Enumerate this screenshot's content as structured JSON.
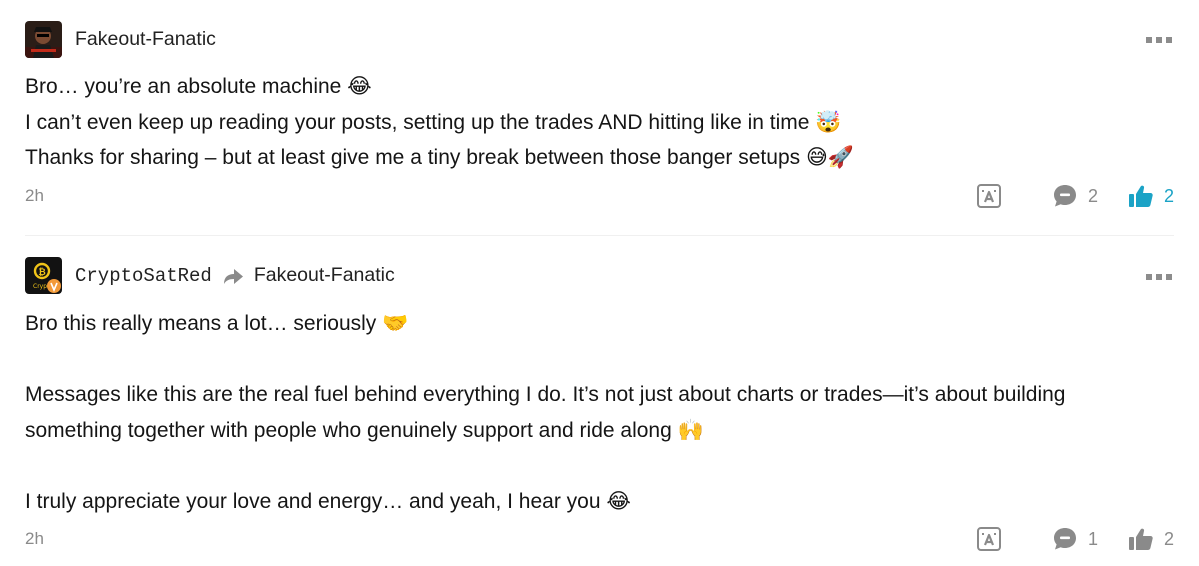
{
  "comments": [
    {
      "author": "Fakeout-Fanatic",
      "lines": [
        "Bro… you’re an absolute machine 😂",
        "I can’t even keep up reading your posts, setting up the trades AND hitting like in time 🤯",
        "Thanks for sharing – but at least give me a tiny break between those banger setups 😅🚀"
      ],
      "time": "2h",
      "reply_count": "2",
      "like_count": "2",
      "liked": true
    },
    {
      "author": "CryptoSatRed",
      "reply_to": "Fakeout-Fanatic",
      "lines": [
        "Bro this really means a lot… seriously 🤝",
        "",
        "Messages like this are the real fuel behind everything I do. It’s not just about charts or trades—it’s about building",
        "something together with people who genuinely support and ride along 🙌",
        "",
        "I truly appreciate your love and energy… and yeah, I hear you 😂"
      ],
      "time": "2h",
      "reply_count": "1",
      "like_count": "2",
      "liked": false
    }
  ],
  "icons": {
    "more": "more-dots-icon",
    "translate": "translate-icon",
    "reply": "comment-bubble-icon",
    "like": "thumbs-up-icon",
    "reply_to": "reply-arrow-icon"
  },
  "colors": {
    "liked": "#1ba3c6",
    "muted": "#8a8a8a",
    "text": "#151515"
  }
}
